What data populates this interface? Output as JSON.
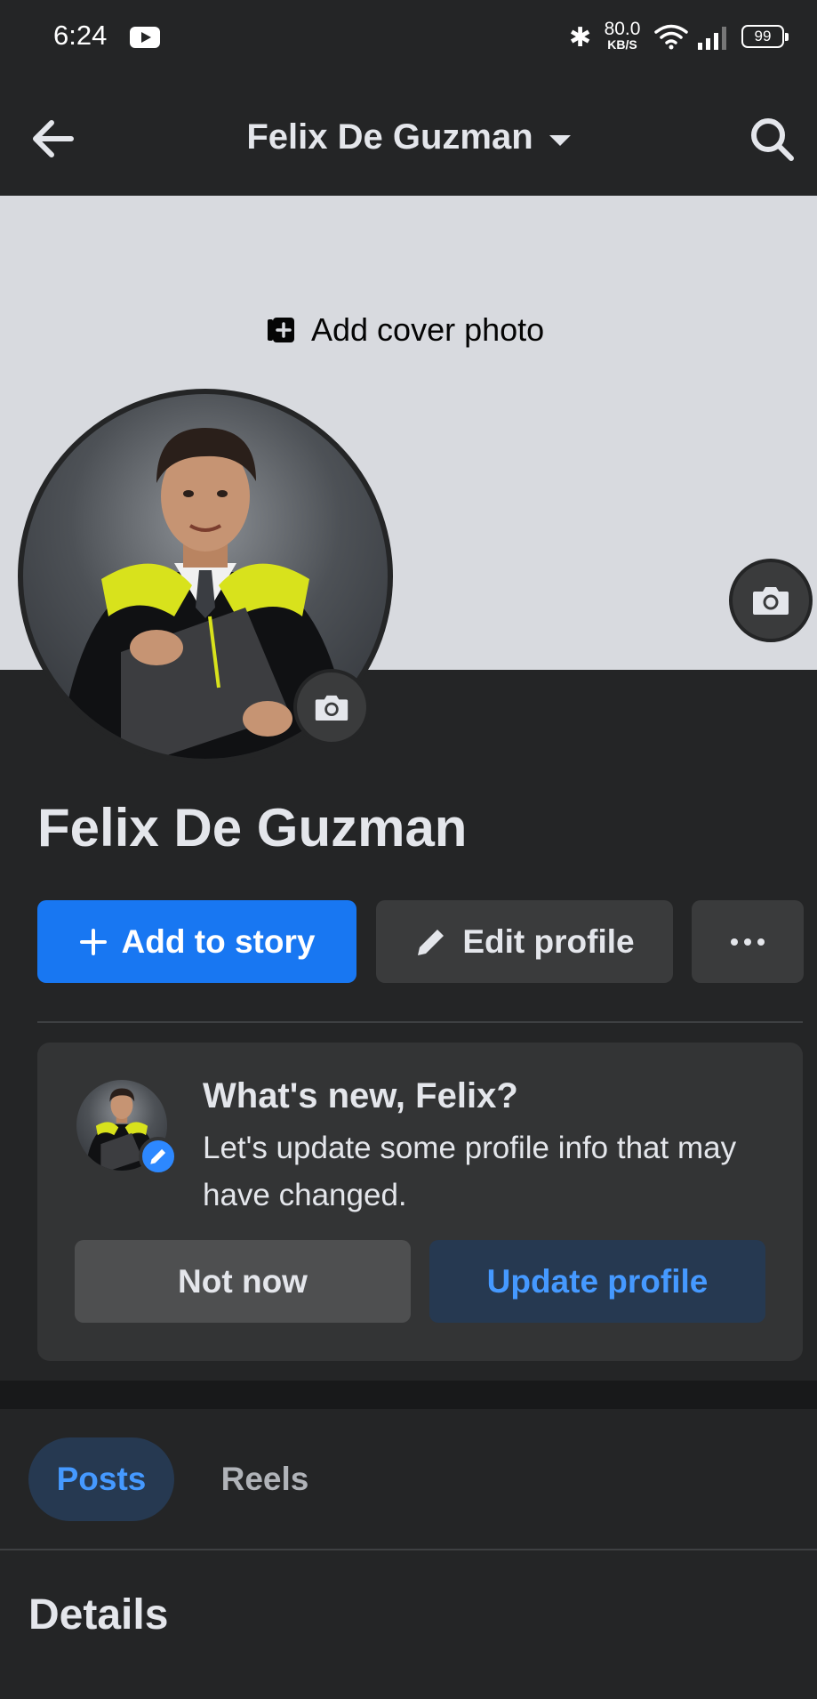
{
  "status_bar": {
    "time": "6:24",
    "network_speed_value": "80.0",
    "network_speed_unit": "KB/S",
    "battery": "99",
    "icons": [
      "youtube-icon",
      "bluetooth-icon",
      "wifi-icon",
      "signal-icon",
      "battery-icon"
    ]
  },
  "header": {
    "title": "Felix De Guzman",
    "back_icon": "back-arrow-icon",
    "search_icon": "search-icon",
    "dropdown_icon": "caret-down-icon"
  },
  "cover": {
    "add_cover_label": "Add cover photo",
    "add_cover_icon": "add-photo-icon",
    "camera_icon": "camera-icon"
  },
  "profile": {
    "name": "Felix De Guzman",
    "avatar": "profile-photo-graduation"
  },
  "actions": {
    "add_story_label": "Add to story",
    "edit_profile_label": "Edit profile",
    "more_icon": "more-dots-icon"
  },
  "prompt_card": {
    "title": "What's new, Felix?",
    "text": "Let's update some profile info that may have changed.",
    "not_now_label": "Not now",
    "update_label": "Update profile"
  },
  "tabs": [
    {
      "label": "Posts",
      "selected": true
    },
    {
      "label": "Reels",
      "selected": false
    }
  ],
  "sections": {
    "details_title": "Details"
  },
  "colors": {
    "background": "#242526",
    "cover": "#d8dadf",
    "primary_blue": "#1877f2",
    "accent_text_blue": "#4599ff",
    "secondary_button": "#3a3b3c",
    "card": "#333435"
  }
}
